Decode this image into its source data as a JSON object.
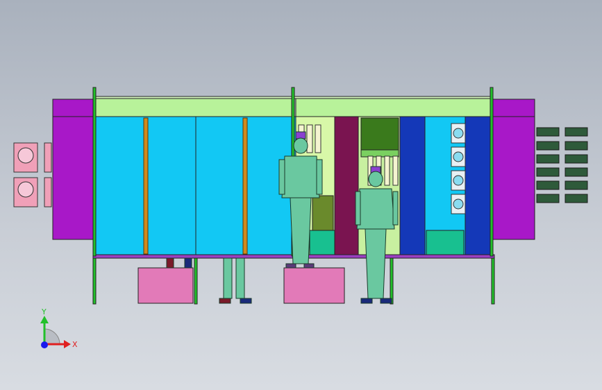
{
  "triad": {
    "y_label": "Y",
    "x_label": "X",
    "y_color": "#22c02a",
    "x_color": "#e02020",
    "z_color": "#1a1aee"
  },
  "colors": {
    "background_top": "#a9b1bd",
    "magenta": "#a818c8",
    "cyan": "#12c8f4",
    "lime": "#b8f29a",
    "orange": "#d08a1c",
    "pink": "#e27ab8",
    "dark_blue": "#1438b8",
    "maroon": "#7a1450",
    "dark_green": "#3a7a1c",
    "teal": "#18c090",
    "figure_green": "#6ac8a0"
  },
  "icons": {
    "fan_unit": "fan-unit-icon",
    "filter_cartridge": "filter-cartridge-icon",
    "axis_triad": "axis-triad-icon"
  }
}
